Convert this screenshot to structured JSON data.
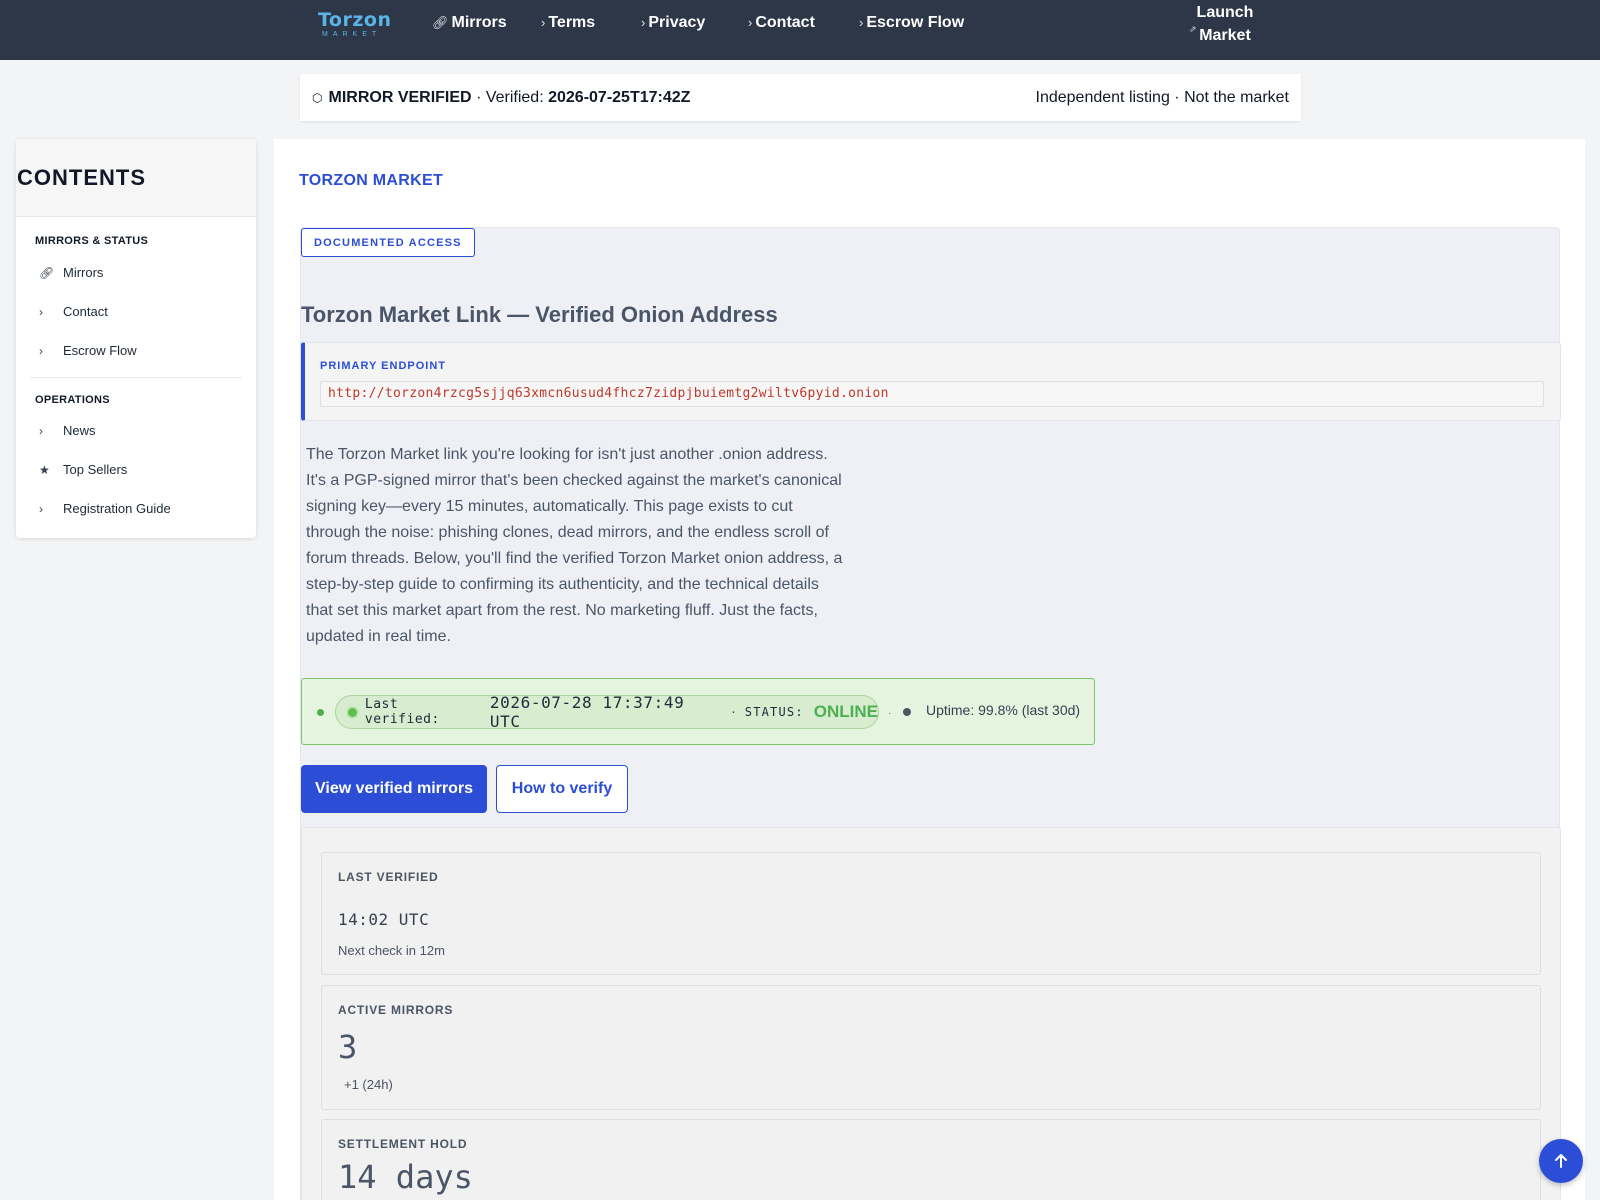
{
  "nav": {
    "logo_text": "Torzon",
    "logo_sub": "MARKET",
    "links": [
      {
        "label": "Mirrors",
        "icon": "link-icon"
      },
      {
        "label": "Terms",
        "icon": "chevron-right-icon"
      },
      {
        "label": "Privacy",
        "icon": "chevron-right-icon"
      },
      {
        "label": "Contact",
        "icon": "chevron-right-icon"
      },
      {
        "label": "Escrow Flow",
        "icon": "chevron-right-icon"
      }
    ],
    "launch_line1": "Launch",
    "launch_line2": "Market"
  },
  "verify_bar": {
    "status": "MIRROR VERIFIED",
    "verified_prefix": "· Verified:",
    "verified_time": "2026-07-25T17:42Z",
    "right_text": "Independent listing · Not the market"
  },
  "sidebar": {
    "title": "CONTENTS",
    "sections": [
      {
        "heading": "MIRRORS & STATUS",
        "items": [
          {
            "label": "Mirrors",
            "icon": "link-icon"
          },
          {
            "label": "Contact",
            "icon": "chevron-right-icon"
          },
          {
            "label": "Escrow Flow",
            "icon": "chevron-right-icon"
          }
        ]
      },
      {
        "heading": "OPERATIONS",
        "items": [
          {
            "label": "News",
            "icon": "chevron-right-icon"
          },
          {
            "label": "Top Sellers",
            "icon": "star-icon"
          },
          {
            "label": "Registration Guide",
            "icon": "chevron-right-icon"
          }
        ]
      }
    ]
  },
  "main": {
    "brand": "TORZON MARKET",
    "badge": "DOCUMENTED ACCESS",
    "title": "Torzon Market Link — Verified Onion Address",
    "endpoint_label": "PRIMARY ENDPOINT",
    "endpoint_url": "http://torzon4rzcg5sjjq63xmcn6usud4fhcz7zidpjbuiemtg2wiltv6pyid.onion",
    "description": "The Torzon Market link you're looking for isn't just another .onion address. It's a PGP-signed mirror that's been checked against the market's canonical signing key—every 15 minutes, automatically. This page exists to cut through the noise: phishing clones, dead mirrors, and the endless scroll of forum threads. Below, you'll find the verified Torzon Market onion address, a step-by-step guide to confirming its authenticity, and the technical details that set this market apart from the rest. No marketing fluff. Just the facts, updated in real time.",
    "status": {
      "last_verified_label": "Last verified:",
      "last_verified_value": "2026-07-28 17:37:49 UTC",
      "separator": "·",
      "status_label": "STATUS:",
      "status_value": "ONLINE",
      "uptime": "Uptime: 99.8% (last 30d)"
    },
    "primary_button": "View verified mirrors",
    "secondary_button": "How to verify",
    "stats": [
      {
        "label": "LAST VERIFIED",
        "value": "14:02 UTC",
        "sub": "Next check in 12m"
      },
      {
        "label": "ACTIVE MIRRORS",
        "value": "3",
        "sub": "+1 (24h)"
      },
      {
        "label": "SETTLEMENT HOLD",
        "value": "14 days"
      }
    ]
  },
  "colors": {
    "nav_bg": "#2d3748",
    "accent": "#2c4ed6",
    "online": "#4caf50",
    "url_red": "#c0392b"
  }
}
